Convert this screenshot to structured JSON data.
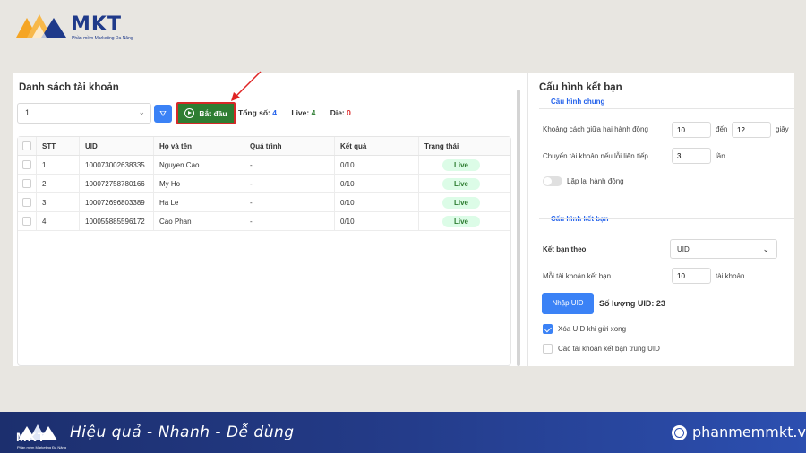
{
  "brand": {
    "logo_text": "MKT",
    "logo_sub": "Phần mềm Marketing Đa Năng",
    "slogan": "Hiệu quả - Nhanh  - Dễ dùng",
    "website": "phanmemmkt.vn",
    "colors": {
      "navy": "#1f3a8a",
      "orange": "#f5a524",
      "banner": "#233a86"
    }
  },
  "left": {
    "title": "Danh sách tài khoản",
    "select_value": "1",
    "start_label": "Bắt đầu",
    "stats": {
      "total_label": "Tổng số:",
      "total": "4",
      "live_label": "Live:",
      "live": "4",
      "die_label": "Die:",
      "die": "0"
    },
    "table": {
      "headers": [
        "STT",
        "UID",
        "Họ và tên",
        "Quá trình",
        "Kết quả",
        "Trạng thái"
      ],
      "rows": [
        {
          "stt": "1",
          "uid": "100073002638335",
          "name": "Nguyen Cao",
          "process": "-",
          "result": "0/10",
          "status": "Live"
        },
        {
          "stt": "2",
          "uid": "100072758780166",
          "name": "My Ho",
          "process": "-",
          "result": "0/10",
          "status": "Live"
        },
        {
          "stt": "3",
          "uid": "100072696803389",
          "name": "Ha Le",
          "process": "-",
          "result": "0/10",
          "status": "Live"
        },
        {
          "stt": "4",
          "uid": "100055885596172",
          "name": "Cao Phan",
          "process": "-",
          "result": "0/10",
          "status": "Live"
        }
      ]
    }
  },
  "right": {
    "title": "Cấu hình kết bạn",
    "general_section": "Cấu hình chung",
    "delay_label": "Khoảng cách giữa hai hành động",
    "delay_from": "10",
    "delay_to_label": "đến",
    "delay_to": "12",
    "delay_unit": "giây",
    "switch_label": "Chuyển tài khoản nếu lỗi liên tiếp",
    "switch_value": "3",
    "switch_unit": "lần",
    "repeat_label": "Lặp lại hành động",
    "friend_section": "Cấu hình kết bạn",
    "friend_by_label": "Kết bạn theo",
    "friend_by_value": "UID",
    "per_account_label": "Mỗi tài khoản kết bạn",
    "per_account_value": "10",
    "per_account_unit": "tài khoản",
    "import_label": "Nhập UID",
    "uid_count": "Số lượng UID: 23",
    "delete_uid_label": "Xóa UID khi gửi xong",
    "dup_uid_label": "Các tài khoản kết bạn trùng UID"
  }
}
